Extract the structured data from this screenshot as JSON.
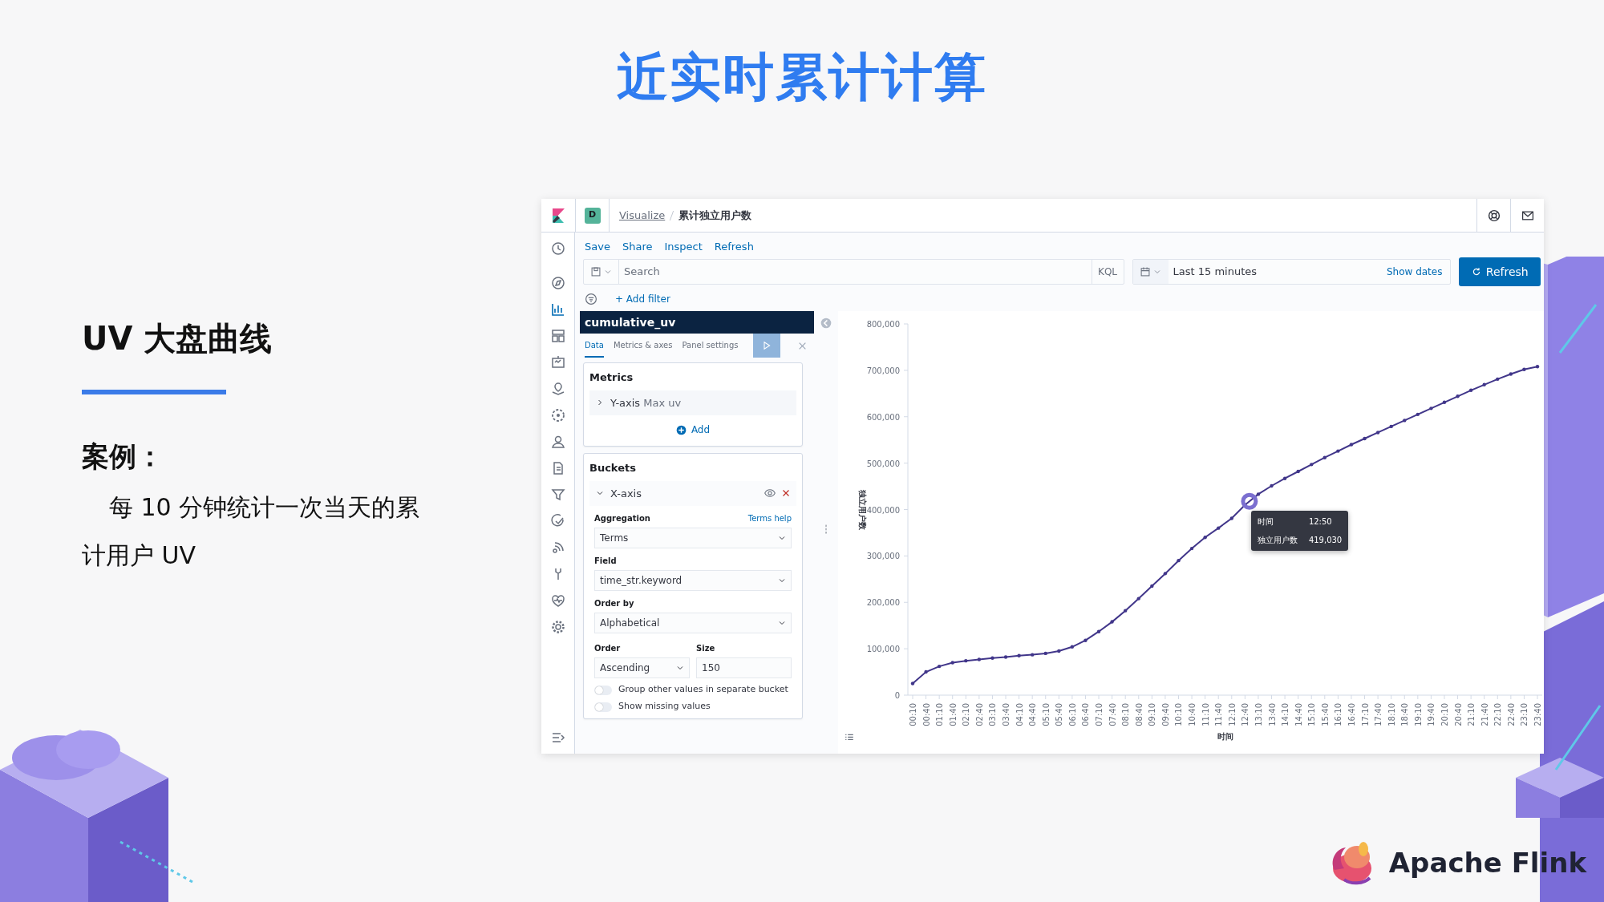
{
  "slide": {
    "title": "近实时累计计算",
    "heading": "UV 大盘曲线",
    "case_label": "案例：",
    "case_text": "每 10 分钟统计一次当天的累计用户 UV",
    "brand": "Apache Flink"
  },
  "kibana": {
    "app_badge": "D",
    "breadcrumbs": [
      {
        "label": "Visualize",
        "kind": "link"
      },
      {
        "label": "累计独立用户数",
        "kind": "current"
      }
    ],
    "top_menu": [
      "Save",
      "Share",
      "Inspect",
      "Refresh"
    ],
    "search": {
      "placeholder": "Search"
    },
    "query_language": "KQL",
    "time_range": "Last 15 minutes",
    "show_dates": "Show dates",
    "refresh_button": "Refresh",
    "add_filter": "+ Add filter",
    "editor": {
      "title": "cumulative_uv",
      "tabs": [
        {
          "label": "Data",
          "selected": true
        },
        {
          "label": "Metrics & axes",
          "selected": false
        },
        {
          "label": "Panel settings",
          "selected": false
        }
      ],
      "metrics": {
        "title": "Metrics",
        "items": [
          {
            "label": "Y-axis",
            "description": "Max uv",
            "expanded": false
          }
        ],
        "add": "Add"
      },
      "buckets": {
        "title": "Buckets",
        "item": {
          "label": "X-axis",
          "expanded": true
        },
        "aggregation": {
          "label": "Aggregation",
          "help": "Terms help",
          "value": "Terms"
        },
        "field": {
          "label": "Field",
          "value": "time_str.keyword"
        },
        "order_by": {
          "label": "Order by",
          "value": "Alphabetical"
        },
        "order": {
          "label": "Order",
          "value": "Ascending"
        },
        "size": {
          "label": "Size",
          "value": "150"
        },
        "toggles": [
          {
            "label": "Group other values in separate bucket",
            "on": false
          },
          {
            "label": "Show missing values",
            "on": false
          }
        ]
      }
    },
    "chart": {
      "chart_data": {
        "type": "line",
        "xlabel": "时间",
        "ylabel": "独立用户数",
        "categories": [
          "00:10",
          "00:40",
          "01:10",
          "01:40",
          "02:10",
          "02:40",
          "03:10",
          "03:40",
          "04:10",
          "04:40",
          "05:10",
          "05:40",
          "06:10",
          "06:40",
          "07:10",
          "07:40",
          "08:10",
          "08:40",
          "09:10",
          "09:40",
          "10:10",
          "10:40",
          "11:10",
          "11:40",
          "12:10",
          "12:40",
          "13:10",
          "13:40",
          "14:10",
          "14:40",
          "15:10",
          "15:40",
          "16:10",
          "16:40",
          "17:10",
          "17:40",
          "18:10",
          "18:40",
          "19:10",
          "19:40",
          "20:10",
          "20:40",
          "21:10",
          "21:40",
          "22:10",
          "22:40",
          "23:10",
          "23:40"
        ],
        "values": [
          25000,
          50000,
          62000,
          70000,
          74000,
          77000,
          80000,
          82000,
          85000,
          87000,
          90000,
          95000,
          104000,
          118000,
          137000,
          158000,
          182000,
          208000,
          235000,
          262000,
          290000,
          316000,
          340000,
          360000,
          381000,
          410000,
          433000,
          451000,
          467000,
          482000,
          497000,
          512000,
          526000,
          540000,
          553000,
          566000,
          579000,
          592000,
          605000,
          618000,
          631000,
          644000,
          657000,
          669000,
          681000,
          692000,
          702000,
          708000
        ],
        "ylim": [
          0,
          800000
        ],
        "yticks": [
          {
            "value": 0,
            "label": "0"
          },
          {
            "value": 100000,
            "label": "100,000"
          },
          {
            "value": 200000,
            "label": "200,000"
          },
          {
            "value": 300000,
            "label": "300,000"
          },
          {
            "value": 400000,
            "label": "400,000"
          },
          {
            "value": 500000,
            "label": "500,000"
          },
          {
            "value": 600000,
            "label": "600,000"
          },
          {
            "value": 700000,
            "label": "700,000"
          },
          {
            "value": 800000,
            "label": "800,000"
          }
        ]
      },
      "tooltip": [
        {
          "label": "时间",
          "value": "12:50"
        },
        {
          "label": "独立用户数",
          "value": "419,030"
        }
      ]
    }
  }
}
